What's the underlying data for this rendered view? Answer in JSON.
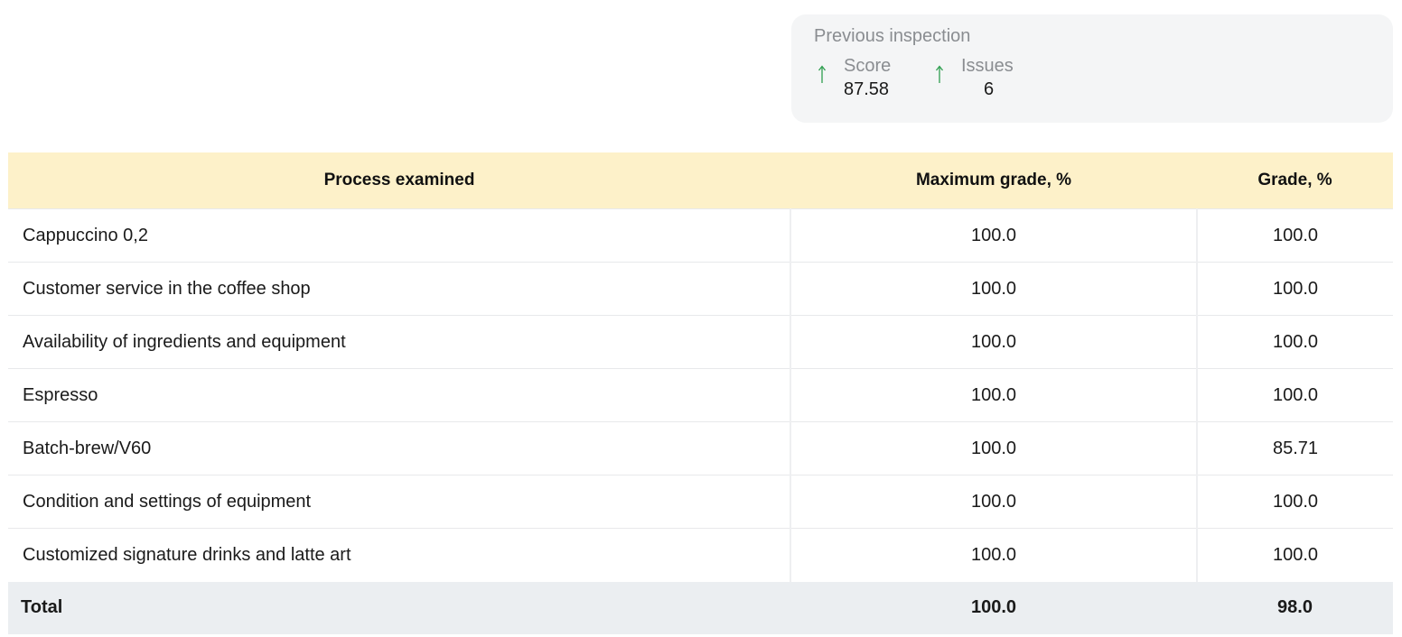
{
  "previous_inspection": {
    "title": "Previous inspection",
    "score": {
      "label": "Score",
      "value": "87.58",
      "trend": "up"
    },
    "issues": {
      "label": "Issues",
      "value": "6",
      "trend": "up"
    }
  },
  "colors": {
    "header_bg": "#fdf1c9",
    "card_bg": "#f4f5f6",
    "total_bg": "#ebeef1",
    "trend_up": "#2e9e4f",
    "muted_text": "#8a8d91"
  },
  "table": {
    "columns": [
      "Process examined",
      "Maximum grade, %",
      "Grade, %"
    ],
    "rows": [
      {
        "process": "Cappuccino 0,2",
        "max": "100.0",
        "grade": "100.0"
      },
      {
        "process": "Customer service in the coffee shop",
        "max": "100.0",
        "grade": "100.0"
      },
      {
        "process": "Availability of ingredients and equipment",
        "max": "100.0",
        "grade": "100.0"
      },
      {
        "process": "Espresso",
        "max": "100.0",
        "grade": "100.0"
      },
      {
        "process": "Batch-brew/V60",
        "max": "100.0",
        "grade": "85.71"
      },
      {
        "process": "Condition and settings of equipment",
        "max": "100.0",
        "grade": "100.0"
      },
      {
        "process": "Customized signature drinks and latte art",
        "max": "100.0",
        "grade": "100.0"
      }
    ],
    "total": {
      "label": "Total",
      "max": "100.0",
      "grade": "98.0"
    }
  }
}
